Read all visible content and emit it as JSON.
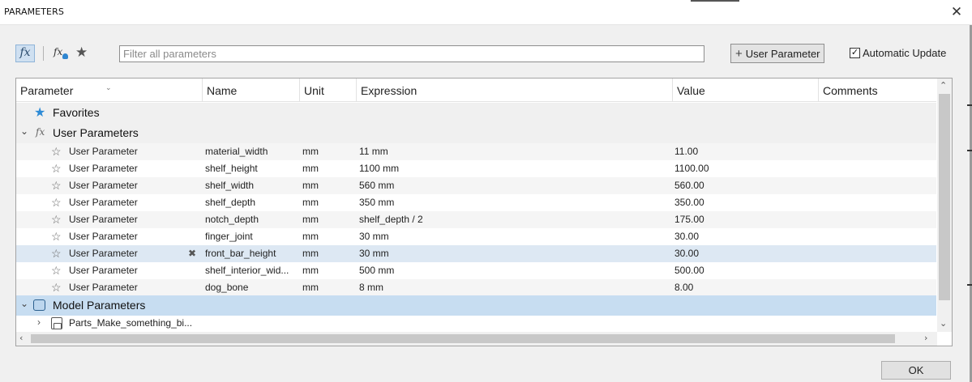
{
  "window": {
    "title": "PARAMETERS",
    "close_glyph": "✕"
  },
  "toolbar": {
    "fx_label": "fx",
    "fx_user_label": "fx",
    "favorites_icon": "star-icon",
    "filter_placeholder": "Filter all parameters",
    "filter_value": "",
    "user_parameter_label": "User Parameter",
    "auto_update_label": "Automatic Update",
    "auto_update_checked": true
  },
  "table": {
    "columns": [
      "Parameter",
      "Name",
      "Unit",
      "Expression",
      "Value",
      "Comments"
    ],
    "groups": {
      "favorites": "Favorites",
      "user_parameters": "User Parameters",
      "model_parameters": "Model Parameters"
    },
    "rows": [
      {
        "parameter": "User Parameter",
        "name": "material_width",
        "unit": "mm",
        "expression": "11 mm",
        "value": "11.00",
        "comments": ""
      },
      {
        "parameter": "User Parameter",
        "name": "shelf_height",
        "unit": "mm",
        "expression": "1100 mm",
        "value": "1100.00",
        "comments": ""
      },
      {
        "parameter": "User Parameter",
        "name": "shelf_width",
        "unit": "mm",
        "expression": "560 mm",
        "value": "560.00",
        "comments": ""
      },
      {
        "parameter": "User Parameter",
        "name": "shelf_depth",
        "unit": "mm",
        "expression": "350 mm",
        "value": "350.00",
        "comments": ""
      },
      {
        "parameter": "User Parameter",
        "name": "notch_depth",
        "unit": "mm",
        "expression": "shelf_depth / 2",
        "value": "175.00",
        "comments": ""
      },
      {
        "parameter": "User Parameter",
        "name": "finger_joint",
        "unit": "mm",
        "expression": "30 mm",
        "value": "30.00",
        "comments": ""
      },
      {
        "parameter": "User Parameter",
        "name": "front_bar_height",
        "unit": "mm",
        "expression": "30 mm",
        "value": "30.00",
        "comments": ""
      },
      {
        "parameter": "User Parameter",
        "name": "shelf_interior_wid...",
        "unit": "mm",
        "expression": "500 mm",
        "value": "500.00",
        "comments": ""
      },
      {
        "parameter": "User Parameter",
        "name": "dog_bone",
        "unit": "mm",
        "expression": "8 mm",
        "value": "8.00",
        "comments": ""
      }
    ],
    "model_child": "Parts_Make_something_bi..."
  },
  "footer": {
    "ok_label": "OK"
  },
  "colors": {
    "selected_row": "#dde8f3",
    "model_group": "#c7ddf1",
    "accent": "#2e8bd6"
  }
}
